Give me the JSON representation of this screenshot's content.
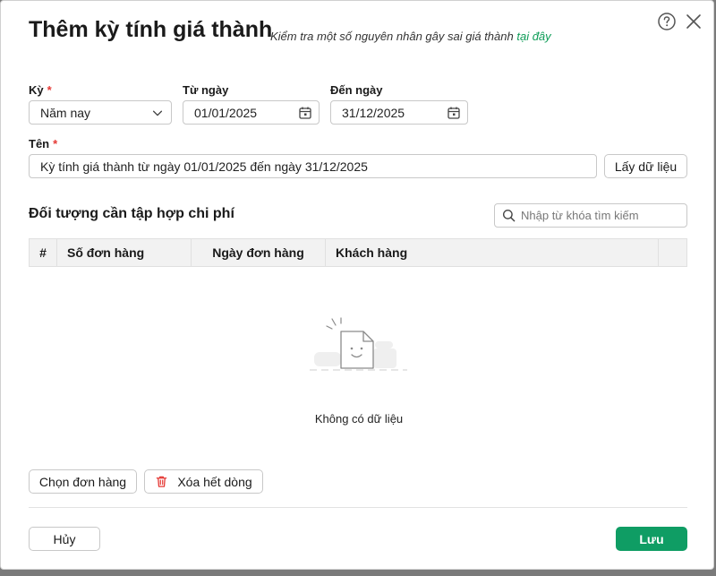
{
  "dialog": {
    "title": "Thêm kỳ tính giá thành",
    "subtitle_text": "Kiểm tra một số nguyên nhân gây sai giá thành",
    "subtitle_link": "tại đây"
  },
  "form": {
    "period": {
      "label": "Kỳ",
      "required_mark": "*",
      "value": "Năm nay"
    },
    "from_date": {
      "label": "Từ ngày",
      "value": "01/01/2025"
    },
    "to_date": {
      "label": "Đến ngày",
      "value": "31/12/2025"
    },
    "name": {
      "label": "Tên",
      "required_mark": "*",
      "value": "Kỳ tính giá thành từ ngày 01/01/2025 đến ngày 31/12/2025"
    },
    "fetch_button": "Lấy dữ liệu"
  },
  "section": {
    "title": "Đối tượng cần tập hợp chi phí",
    "search_placeholder": "Nhập từ khóa tìm kiếm"
  },
  "table": {
    "columns": [
      "#",
      "Số đơn hàng",
      "Ngày đơn hàng",
      "Khách hàng"
    ],
    "empty_text": "Không có dữ liệu"
  },
  "actions": {
    "choose_orders": "Chọn đơn hàng",
    "delete_all_rows": "Xóa hết dòng",
    "cancel": "Hủy",
    "save": "Lưu"
  },
  "colors": {
    "accent": "#0f9d64",
    "required": "#e53935",
    "delete_icon": "#e53935"
  }
}
